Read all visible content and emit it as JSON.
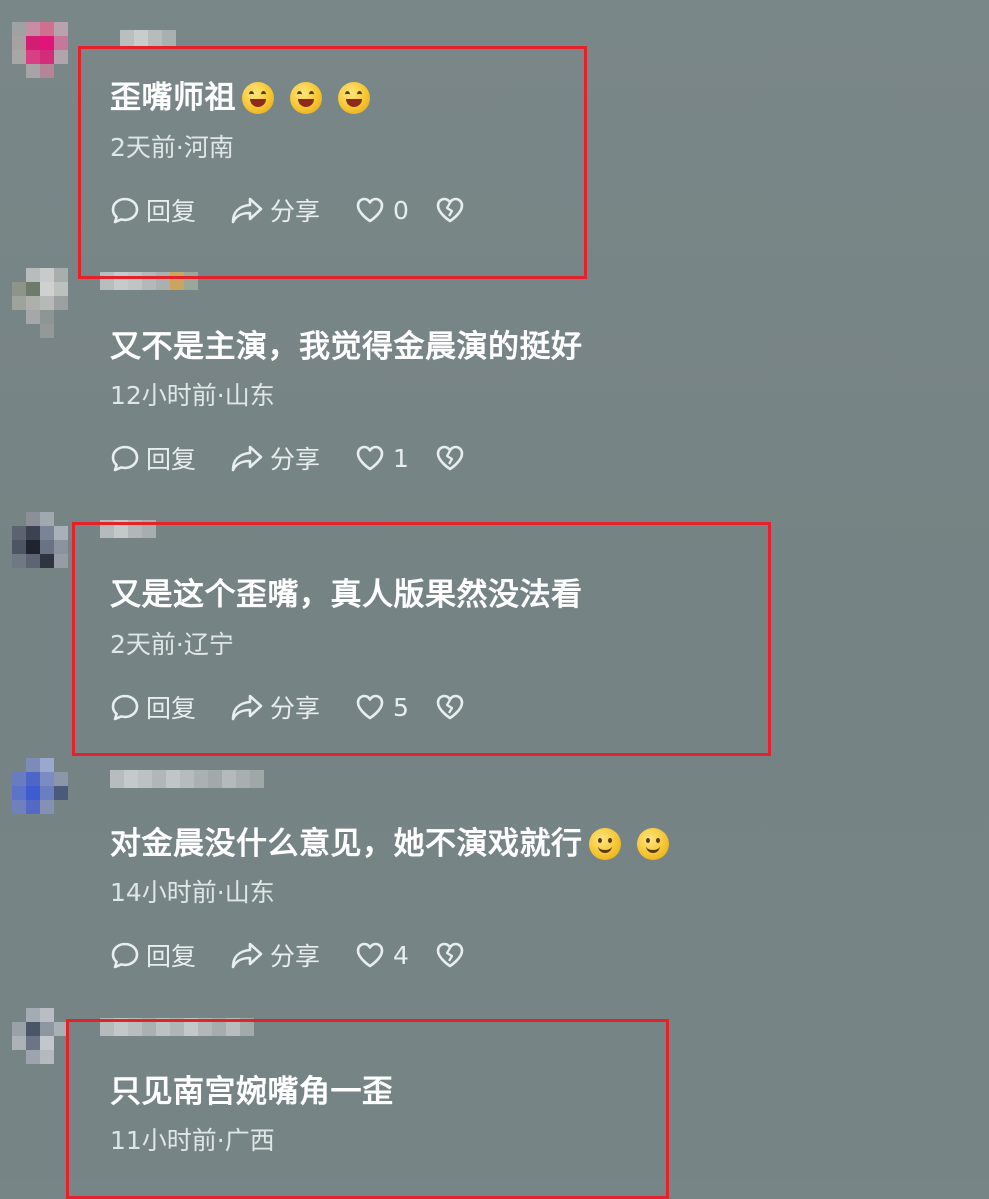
{
  "comments": [
    {
      "content": "歪嘴师祖",
      "emoji_count": 3,
      "emoji_style": "grin-laugh",
      "meta": "2天前·河南",
      "reply_label": "回复",
      "share_label": "分享",
      "like_count": "0",
      "highlighted": true
    },
    {
      "content": "又不是主演，我觉得金晨演的挺好",
      "emoji_count": 0,
      "meta": "12小时前·山东",
      "reply_label": "回复",
      "share_label": "分享",
      "like_count": "1",
      "highlighted": false
    },
    {
      "content": "又是这个歪嘴，真人版果然没法看",
      "emoji_count": 0,
      "meta": "2天前·辽宁",
      "reply_label": "回复",
      "share_label": "分享",
      "like_count": "5",
      "highlighted": true
    },
    {
      "content": "对金晨没什么意见，她不演戏就行",
      "emoji_count": 2,
      "emoji_style": "smile",
      "meta": "14小时前·山东",
      "reply_label": "回复",
      "share_label": "分享",
      "like_count": "4",
      "highlighted": false
    },
    {
      "content": "只见南宫婉嘴角一歪",
      "emoji_count": 0,
      "meta": "11小时前·广西",
      "highlighted": true
    }
  ],
  "icons": {
    "reply": "comment-bubble-icon",
    "share": "share-arrow-icon",
    "like": "heart-outline-icon",
    "dislike": "broken-heart-icon"
  },
  "colors": {
    "background": "#778587",
    "highlight_box": "#e3222b",
    "text": "#ffffff",
    "meta_text": "#dfe6e7"
  }
}
